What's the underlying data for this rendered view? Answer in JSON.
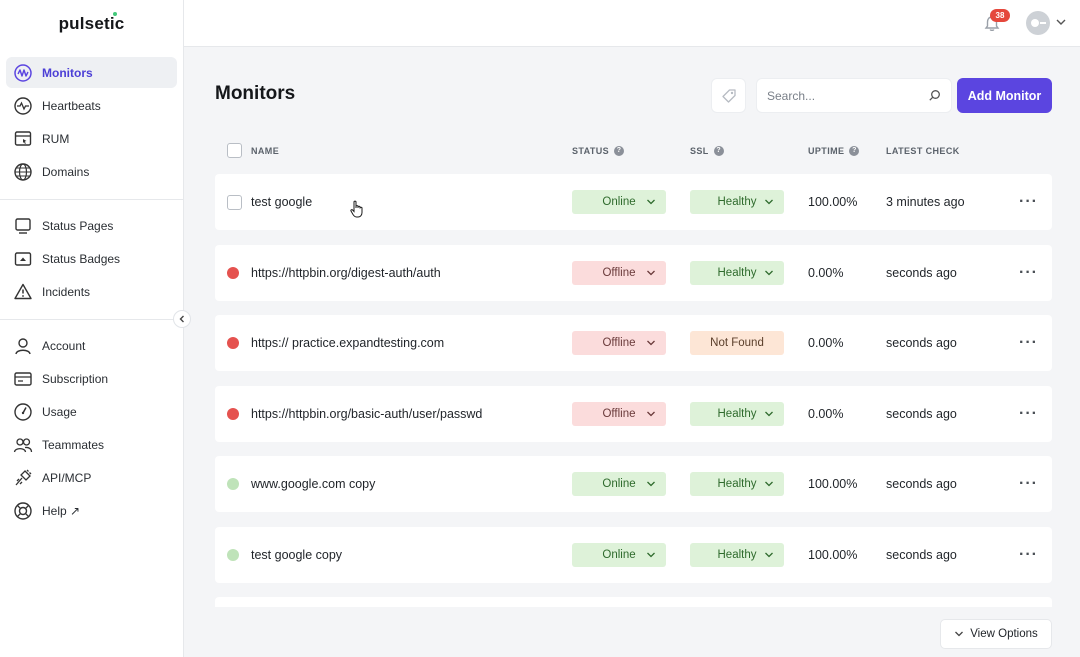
{
  "app": {
    "logo": "pulsetic"
  },
  "sidebar": {
    "groups": [
      [
        {
          "label": "Monitors",
          "icon": "monitors-icon",
          "active": true
        },
        {
          "label": "Heartbeats",
          "icon": "heartbeat-icon"
        },
        {
          "label": "RUM",
          "icon": "rum-icon"
        },
        {
          "label": "Domains",
          "icon": "globe-icon"
        }
      ],
      [
        {
          "label": "Status Pages",
          "icon": "status-page-icon"
        },
        {
          "label": "Status Badges",
          "icon": "status-badge-icon"
        },
        {
          "label": "Incidents",
          "icon": "warning-icon"
        }
      ],
      [
        {
          "label": "Account",
          "icon": "user-icon"
        },
        {
          "label": "Subscription",
          "icon": "card-icon"
        },
        {
          "label": "Usage",
          "icon": "gauge-icon"
        },
        {
          "label": "Teammates",
          "icon": "team-icon"
        },
        {
          "label": "API/MCP",
          "icon": "plug-icon"
        },
        {
          "label": "Help ↗",
          "icon": "lifebuoy-icon"
        }
      ]
    ]
  },
  "topbar": {
    "notifications_count": "38"
  },
  "page": {
    "title": "Monitors",
    "search_placeholder": "Search...",
    "add_button": "Add Monitor",
    "view_options": "View Options"
  },
  "table": {
    "headers": {
      "name": "NAME",
      "status": "STATUS",
      "ssl": "SSL",
      "uptime": "UPTIME",
      "latest": "LATEST CHECK"
    },
    "rows": [
      {
        "marker": "checkbox",
        "name": "test google",
        "status": "Online",
        "ssl": "Healthy",
        "uptime": "100.00%",
        "latest": "3 minutes ago"
      },
      {
        "marker": "#e5524f",
        "name": "https://httpbin.org/digest-auth/auth",
        "status": "Offline",
        "ssl": "Healthy",
        "uptime": "0.00%",
        "latest": "seconds ago"
      },
      {
        "marker": "#e5524f",
        "name": "https:// practice.expandtesting.com",
        "status": "Offline",
        "ssl": "Not Found",
        "uptime": "0.00%",
        "latest": "seconds ago"
      },
      {
        "marker": "#e5524f",
        "name": "https://httpbin.org/basic-auth/user/passwd",
        "status": "Offline",
        "ssl": "Healthy",
        "uptime": "0.00%",
        "latest": "seconds ago"
      },
      {
        "marker": "#bfe3b9",
        "name": "www.google.com copy",
        "status": "Online",
        "ssl": "Healthy",
        "uptime": "100.00%",
        "latest": "seconds ago"
      },
      {
        "marker": "#bfe3b9",
        "name": "test google copy",
        "status": "Online",
        "ssl": "Healthy",
        "uptime": "100.00%",
        "latest": "seconds ago"
      }
    ]
  },
  "colors": {
    "accent": "#5b45e0",
    "offline": "#e5524f",
    "online": "#bfe3b9",
    "badge": "#e5483c"
  }
}
